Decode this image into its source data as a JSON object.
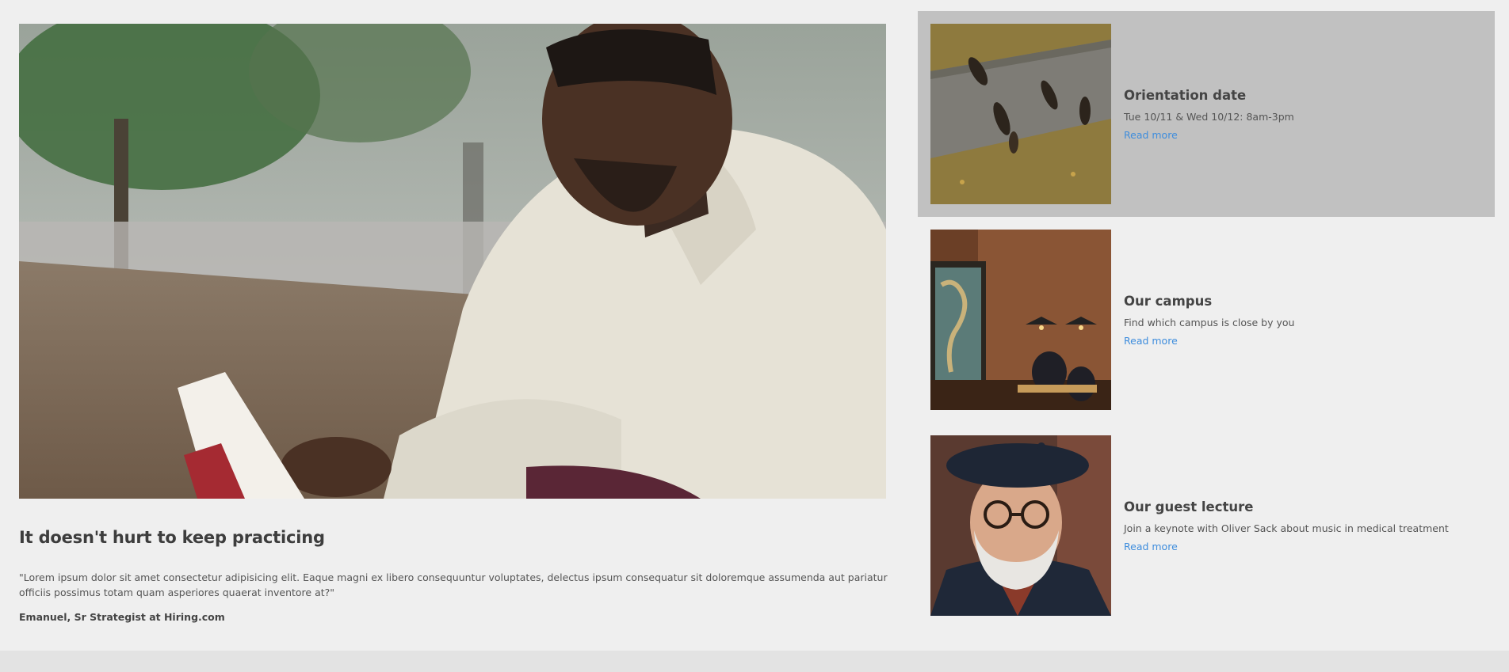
{
  "feature": {
    "title": "It doesn't hurt to keep practicing",
    "quote": "\"Lorem ipsum dolor sit amet consectetur adipisicing elit. Eaque magni ex libero consequuntur voluptates, delectus ipsum consequatur sit doloremque assumenda aut pariatur officiis possimus totam quam asperiores quaerat inventore at?\"",
    "author": "Emanuel, Sr Strategist at Hiring.com"
  },
  "events": [
    {
      "title": "Orientation date",
      "description": "Tue 10/11 & Wed 10/12: 8am-3pm",
      "link": "Read more"
    },
    {
      "title": "Our campus",
      "description": "Find which campus is close by you",
      "link": "Read more"
    },
    {
      "title": "Our guest lecture",
      "description": "Join a keynote with Oliver Sack about music in medical treatment",
      "link": "Read more"
    }
  ],
  "colors": {
    "background": "#efefef",
    "active_card": "#c1c1c1",
    "link": "#3e8ddd",
    "heading": "#3d3d3d"
  }
}
